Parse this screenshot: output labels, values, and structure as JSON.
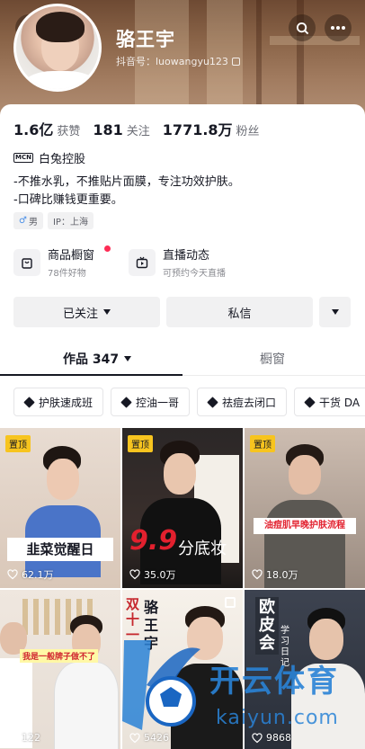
{
  "profile": {
    "name": "骆王宇",
    "douyin_id": "抖音号：luowangyu123"
  },
  "header": {
    "back_icon": "chevron-left-icon",
    "search_icon": "search-icon",
    "more_icon": "more-icon"
  },
  "stats": [
    {
      "num": "1.6亿",
      "label": "获赞"
    },
    {
      "num": "181",
      "label": "关注"
    },
    {
      "num": "1771.8万",
      "label": "粉丝"
    }
  ],
  "org": {
    "badge": "MCN",
    "name": "白兔控股"
  },
  "bio": [
    "-不推水乳，不推贴片面膜，专注功效护肤。",
    "-口碑比赚钱更重要。"
  ],
  "tags": {
    "gender_symbol": "♂",
    "gender": "男",
    "ip": "IP：上海"
  },
  "entries": [
    {
      "title": "商品橱窗",
      "sub": "78件好物"
    },
    {
      "title": "直播动态",
      "sub": "可预约今天直播"
    }
  ],
  "actions": {
    "follow": "已关注",
    "message": "私信"
  },
  "tabs": [
    {
      "label": "作品 347"
    },
    {
      "label": "橱窗"
    }
  ],
  "chips": [
    "护肤速成班",
    "控油一哥",
    "祛痘去闭口",
    "干货 DA"
  ],
  "videos": [
    {
      "pinned": "置顶",
      "likes": "62.1万",
      "caption": "韭菜觉醒日"
    },
    {
      "pinned": "置顶",
      "likes": "35.0万",
      "caption": "分底妆",
      "big": "9.9"
    },
    {
      "pinned": "置顶",
      "likes": "18.0万",
      "caption": "油痘肌早晚护肤流程"
    },
    {
      "likes": "122",
      "caption": "我是一般牌子做不了"
    },
    {
      "likes": "5426",
      "caption_v": "双十一",
      "caption_name": "骆王宇"
    },
    {
      "likes": "9868",
      "caption": "欧皮会",
      "sub": "学习日记"
    }
  ],
  "watermark": {
    "brand": "开云体育",
    "domain": "kaiyun.com"
  },
  "colors": {
    "pin": "#f7c41f",
    "accent_red": "#fe2c55",
    "text": "#161823"
  }
}
